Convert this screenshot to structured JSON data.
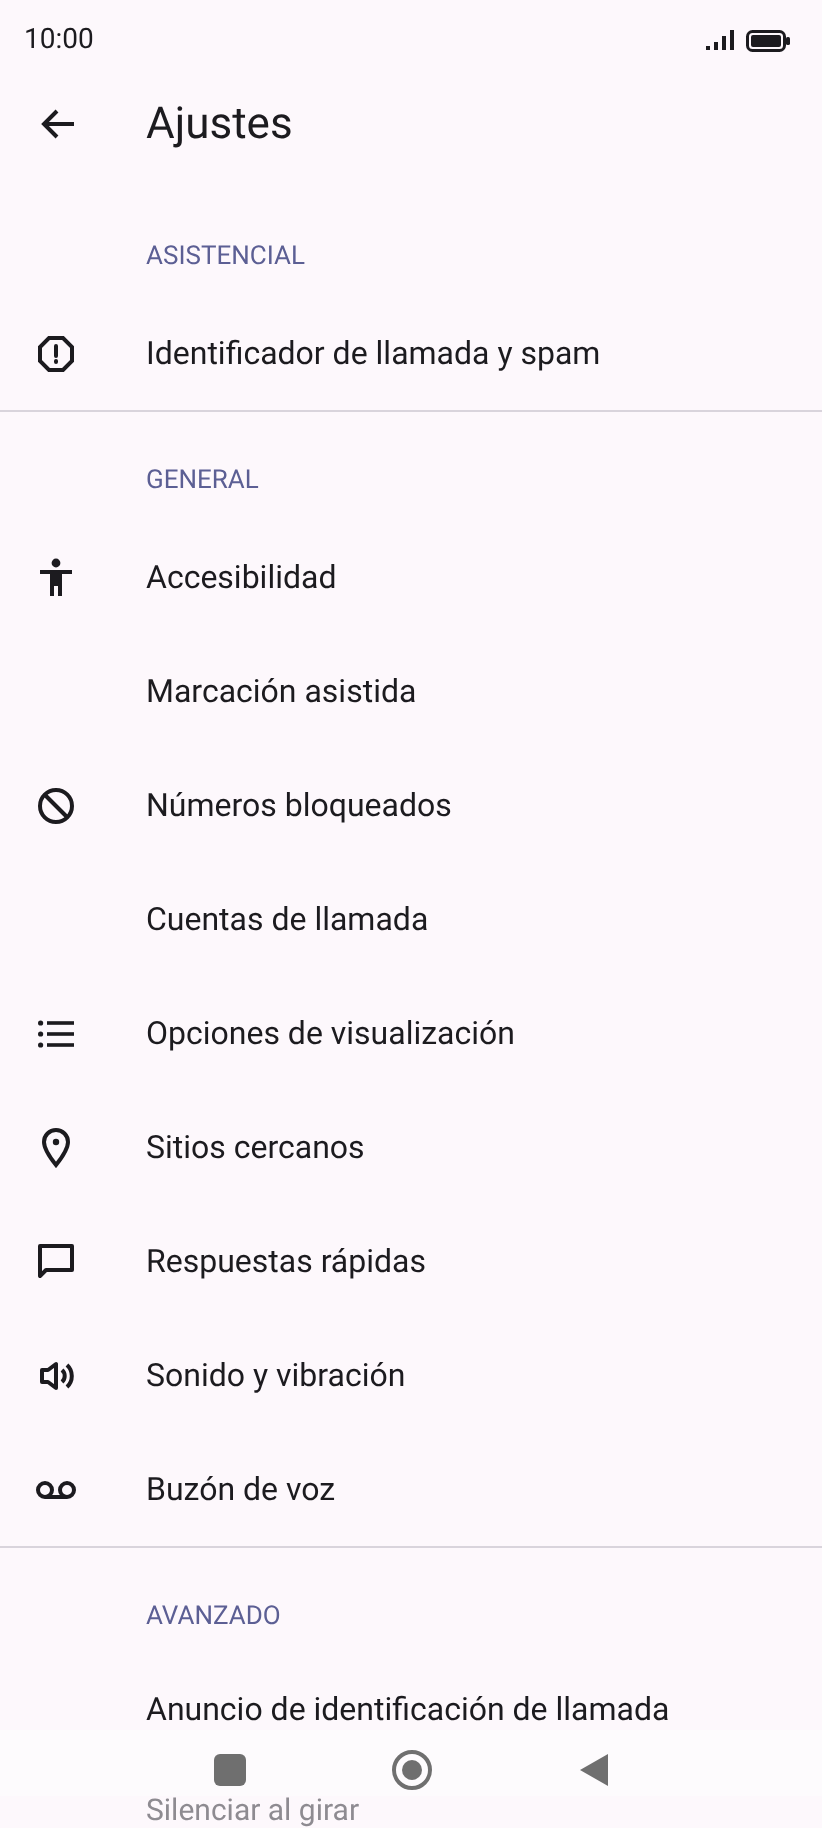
{
  "status_bar": {
    "time": "10:00"
  },
  "app_bar": {
    "title": "Ajustes"
  },
  "sections": [
    {
      "title": "ASISTENCIAL",
      "items": [
        {
          "label": "Identificador de llamada y spam"
        }
      ]
    },
    {
      "title": "GENERAL",
      "items": [
        {
          "label": "Accesibilidad"
        },
        {
          "label": "Marcación asistida"
        },
        {
          "label": "Números bloqueados"
        },
        {
          "label": "Cuentas de llamada"
        },
        {
          "label": "Opciones de visualización"
        },
        {
          "label": "Sitios cercanos"
        },
        {
          "label": "Respuestas rápidas"
        },
        {
          "label": "Sonido y vibración"
        },
        {
          "label": "Buzón de voz"
        }
      ]
    },
    {
      "title": "AVANZADO",
      "items": [
        {
          "label": "Anuncio de identificación de llamada"
        },
        {
          "label": "Silenciar al girar"
        }
      ]
    }
  ]
}
